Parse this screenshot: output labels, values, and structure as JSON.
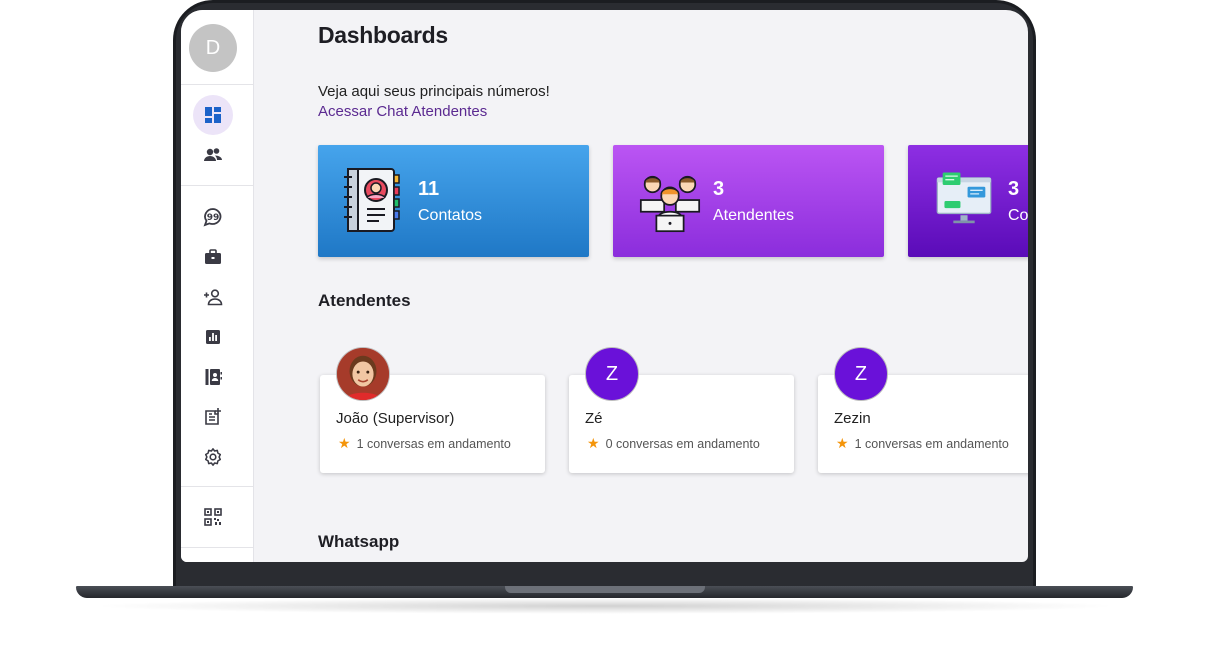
{
  "app": {
    "title": "Dashboards",
    "subtitle": "Veja aqui seus principais números!",
    "link": "Acessar Chat Atendentes"
  },
  "sidebar": {
    "avatar_letter": "D",
    "items": [
      {
        "name": "dashboard-icon",
        "active": true
      },
      {
        "name": "contacts-group-icon"
      },
      {
        "name": "chat-quote-icon"
      },
      {
        "name": "briefcase-icon"
      },
      {
        "name": "add-person-icon"
      },
      {
        "name": "bar-chart-icon"
      },
      {
        "name": "contact-book-icon"
      },
      {
        "name": "note-add-icon"
      },
      {
        "name": "settings-gear-icon"
      },
      {
        "name": "qr-code-icon"
      }
    ]
  },
  "stats": [
    {
      "value": "11",
      "label": "Contatos",
      "icon": "address-book-icon",
      "color": "#2d8ddb"
    },
    {
      "value": "3",
      "label": "Atendentes",
      "icon": "team-icon",
      "color": "#a640ea"
    },
    {
      "value": "3",
      "label": "Co",
      "icon": "chat-monitor-icon",
      "color": "#6f17cc"
    }
  ],
  "sections": {
    "atendentes": "Atendentes",
    "whatsapp": "Whatsapp"
  },
  "agents": [
    {
      "initial": "",
      "name": "João (Supervisor)",
      "status": "1 conversas em andamento",
      "photo": true
    },
    {
      "initial": "Z",
      "name": "Zé",
      "status": "0 conversas em andamento",
      "photo": false
    },
    {
      "initial": "Z",
      "name": "Zezin",
      "status": "1 conversas em andamento",
      "photo": false
    }
  ],
  "star_glyph": "★",
  "fab": {
    "icon": "menu-icon",
    "glyph": "≡"
  },
  "colors": {
    "accent": "#5b2a91",
    "avatar_purple": "#6a11d9",
    "fab": "#26c281",
    "star": "#f4950b"
  }
}
